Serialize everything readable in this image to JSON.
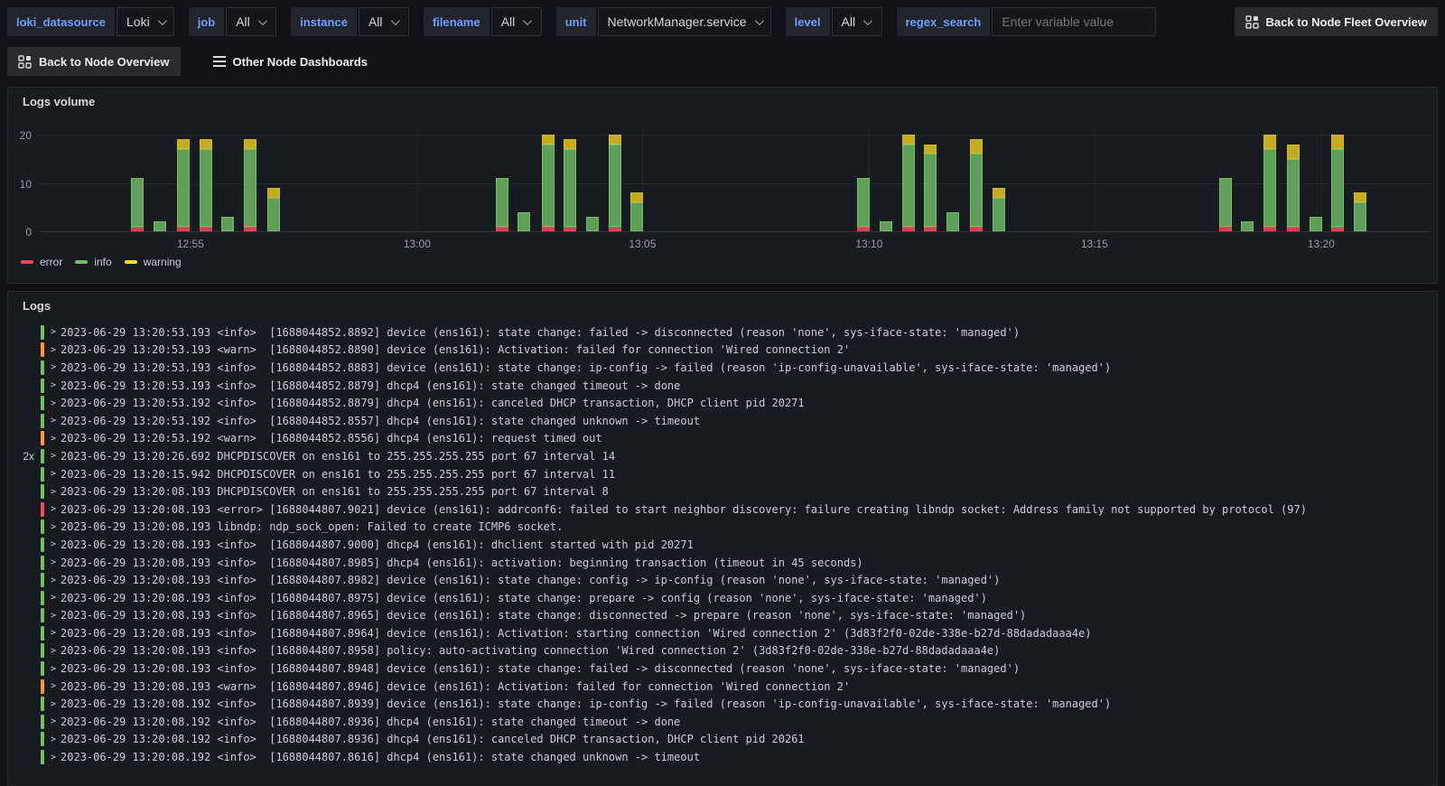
{
  "variables": [
    {
      "label": "loki_datasource",
      "type": "select",
      "value": "Loki"
    },
    {
      "label": "job",
      "type": "select",
      "value": "All"
    },
    {
      "label": "instance",
      "type": "select",
      "value": "All"
    },
    {
      "label": "filename",
      "type": "select",
      "value": "All"
    },
    {
      "label": "unit",
      "type": "select",
      "value": "NetworkManager.service"
    },
    {
      "label": "level",
      "type": "select",
      "value": "All"
    },
    {
      "label": "regex_search",
      "type": "input",
      "value": "",
      "placeholder": "Enter variable value"
    }
  ],
  "toolbar": {
    "fleet_button_label": "Back to Node Fleet Overview",
    "node_overview_label": "Back to Node Overview",
    "other_dashboards_label": "Other Node Dashboards"
  },
  "panels": {
    "logs_volume": {
      "title": "Logs volume"
    },
    "logs": {
      "title": "Logs"
    }
  },
  "chart_data": {
    "type": "bar",
    "title": "Logs volume",
    "stacked": true,
    "ylim": [
      0,
      20
    ],
    "yticks": [
      0,
      10,
      20
    ],
    "grid": true,
    "legend_position": "bottom",
    "series_names": [
      "error",
      "info",
      "warning"
    ],
    "colors": {
      "error": "#F2495C",
      "info": "#73BF69",
      "warning": "#FADE2A"
    },
    "xticks": [
      {
        "label": "12:55",
        "frac": 0.109
      },
      {
        "label": "13:00",
        "frac": 0.272
      },
      {
        "label": "13:05",
        "frac": 0.434
      },
      {
        "label": "13:10",
        "frac": 0.597
      },
      {
        "label": "13:15",
        "frac": 0.759
      },
      {
        "label": "13:20",
        "frac": 0.922
      }
    ],
    "bars": [
      {
        "x_frac": 0.071,
        "error": 1,
        "info": 10,
        "warning": 0
      },
      {
        "x_frac": 0.087,
        "error": 0,
        "info": 2,
        "warning": 0
      },
      {
        "x_frac": 0.104,
        "error": 1,
        "info": 16,
        "warning": 2
      },
      {
        "x_frac": 0.12,
        "error": 1,
        "info": 16,
        "warning": 2
      },
      {
        "x_frac": 0.136,
        "error": 0,
        "info": 3,
        "warning": 0
      },
      {
        "x_frac": 0.152,
        "error": 1,
        "info": 16,
        "warning": 2
      },
      {
        "x_frac": 0.169,
        "error": 0,
        "info": 7,
        "warning": 2
      },
      {
        "x_frac": 0.333,
        "error": 1,
        "info": 10,
        "warning": 0
      },
      {
        "x_frac": 0.349,
        "error": 0,
        "info": 4,
        "warning": 0
      },
      {
        "x_frac": 0.366,
        "error": 1,
        "info": 17,
        "warning": 2
      },
      {
        "x_frac": 0.382,
        "error": 1,
        "info": 16,
        "warning": 2
      },
      {
        "x_frac": 0.398,
        "error": 0,
        "info": 3,
        "warning": 0
      },
      {
        "x_frac": 0.414,
        "error": 1,
        "info": 17,
        "warning": 2
      },
      {
        "x_frac": 0.43,
        "error": 0,
        "info": 6,
        "warning": 2
      },
      {
        "x_frac": 0.593,
        "error": 1,
        "info": 10,
        "warning": 0
      },
      {
        "x_frac": 0.609,
        "error": 0,
        "info": 2,
        "warning": 0
      },
      {
        "x_frac": 0.625,
        "error": 1,
        "info": 17,
        "warning": 2
      },
      {
        "x_frac": 0.641,
        "error": 1,
        "info": 15,
        "warning": 2
      },
      {
        "x_frac": 0.657,
        "error": 0,
        "info": 4,
        "warning": 0
      },
      {
        "x_frac": 0.674,
        "error": 1,
        "info": 15,
        "warning": 3
      },
      {
        "x_frac": 0.69,
        "error": 0,
        "info": 7,
        "warning": 2
      },
      {
        "x_frac": 0.853,
        "error": 1,
        "info": 10,
        "warning": 0
      },
      {
        "x_frac": 0.869,
        "error": 0,
        "info": 2,
        "warning": 0
      },
      {
        "x_frac": 0.885,
        "error": 1,
        "info": 16,
        "warning": 3
      },
      {
        "x_frac": 0.902,
        "error": 1,
        "info": 14,
        "warning": 3
      },
      {
        "x_frac": 0.918,
        "error": 0,
        "info": 3,
        "warning": 0
      },
      {
        "x_frac": 0.934,
        "error": 1,
        "info": 16,
        "warning": 3
      },
      {
        "x_frac": 0.95,
        "error": 0,
        "info": 6,
        "warning": 2
      }
    ]
  },
  "logs": {
    "title": "Logs",
    "rows": [
      {
        "count": "",
        "level": "info",
        "text": "2023-06-29 13:20:53.193 <info>  [1688044852.8892] device (ens161): state change: failed -> disconnected (reason 'none', sys-iface-state: 'managed')"
      },
      {
        "count": "",
        "level": "warn",
        "text": "2023-06-29 13:20:53.193 <warn>  [1688044852.8890] device (ens161): Activation: failed for connection 'Wired connection 2'"
      },
      {
        "count": "",
        "level": "info",
        "text": "2023-06-29 13:20:53.193 <info>  [1688044852.8883] device (ens161): state change: ip-config -> failed (reason 'ip-config-unavailable', sys-iface-state: 'managed')"
      },
      {
        "count": "",
        "level": "info",
        "text": "2023-06-29 13:20:53.193 <info>  [1688044852.8879] dhcp4 (ens161): state changed timeout -> done"
      },
      {
        "count": "",
        "level": "info",
        "text": "2023-06-29 13:20:53.192 <info>  [1688044852.8879] dhcp4 (ens161): canceled DHCP transaction, DHCP client pid 20271"
      },
      {
        "count": "",
        "level": "info",
        "text": "2023-06-29 13:20:53.192 <info>  [1688044852.8557] dhcp4 (ens161): state changed unknown -> timeout"
      },
      {
        "count": "",
        "level": "warn",
        "text": "2023-06-29 13:20:53.192 <warn>  [1688044852.8556] dhcp4 (ens161): request timed out"
      },
      {
        "count": "2x",
        "level": "info",
        "text": "2023-06-29 13:20:26.692 DHCPDISCOVER on ens161 to 255.255.255.255 port 67 interval 14"
      },
      {
        "count": "",
        "level": "info",
        "text": "2023-06-29 13:20:15.942 DHCPDISCOVER on ens161 to 255.255.255.255 port 67 interval 11"
      },
      {
        "count": "",
        "level": "info",
        "text": "2023-06-29 13:20:08.193 DHCPDISCOVER on ens161 to 255.255.255.255 port 67 interval 8"
      },
      {
        "count": "",
        "level": "error",
        "text": "2023-06-29 13:20:08.193 <error> [1688044807.9021] device (ens161): addrconf6: failed to start neighbor discovery: failure creating libndp socket: Address family not supported by protocol (97)"
      },
      {
        "count": "",
        "level": "info",
        "text": "2023-06-29 13:20:08.193 libndp: ndp_sock_open: Failed to create ICMP6 socket."
      },
      {
        "count": "",
        "level": "info",
        "text": "2023-06-29 13:20:08.193 <info>  [1688044807.9000] dhcp4 (ens161): dhclient started with pid 20271"
      },
      {
        "count": "",
        "level": "info",
        "text": "2023-06-29 13:20:08.193 <info>  [1688044807.8985] dhcp4 (ens161): activation: beginning transaction (timeout in 45 seconds)"
      },
      {
        "count": "",
        "level": "info",
        "text": "2023-06-29 13:20:08.193 <info>  [1688044807.8982] device (ens161): state change: config -> ip-config (reason 'none', sys-iface-state: 'managed')"
      },
      {
        "count": "",
        "level": "info",
        "text": "2023-06-29 13:20:08.193 <info>  [1688044807.8975] device (ens161): state change: prepare -> config (reason 'none', sys-iface-state: 'managed')"
      },
      {
        "count": "",
        "level": "info",
        "text": "2023-06-29 13:20:08.193 <info>  [1688044807.8965] device (ens161): state change: disconnected -> prepare (reason 'none', sys-iface-state: 'managed')"
      },
      {
        "count": "",
        "level": "info",
        "text": "2023-06-29 13:20:08.193 <info>  [1688044807.8964] device (ens161): Activation: starting connection 'Wired connection 2' (3d83f2f0-02de-338e-b27d-88dadadaaa4e)"
      },
      {
        "count": "",
        "level": "info",
        "text": "2023-06-29 13:20:08.193 <info>  [1688044807.8958] policy: auto-activating connection 'Wired connection 2' (3d83f2f0-02de-338e-b27d-88dadadaaa4e)"
      },
      {
        "count": "",
        "level": "info",
        "text": "2023-06-29 13:20:08.193 <info>  [1688044807.8948] device (ens161): state change: failed -> disconnected (reason 'none', sys-iface-state: 'managed')"
      },
      {
        "count": "",
        "level": "warn",
        "text": "2023-06-29 13:20:08.193 <warn>  [1688044807.8946] device (ens161): Activation: failed for connection 'Wired connection 2'"
      },
      {
        "count": "",
        "level": "info",
        "text": "2023-06-29 13:20:08.192 <info>  [1688044807.8939] device (ens161): state change: ip-config -> failed (reason 'ip-config-unavailable', sys-iface-state: 'managed')"
      },
      {
        "count": "",
        "level": "info",
        "text": "2023-06-29 13:20:08.192 <info>  [1688044807.8936] dhcp4 (ens161): state changed timeout -> done"
      },
      {
        "count": "",
        "level": "info",
        "text": "2023-06-29 13:20:08.192 <info>  [1688044807.8936] dhcp4 (ens161): canceled DHCP transaction, DHCP client pid 20261"
      },
      {
        "count": "",
        "level": "info",
        "text": "2023-06-29 13:20:08.192 <info>  [1688044807.8616] dhcp4 (ens161): state changed unknown -> timeout"
      }
    ]
  }
}
